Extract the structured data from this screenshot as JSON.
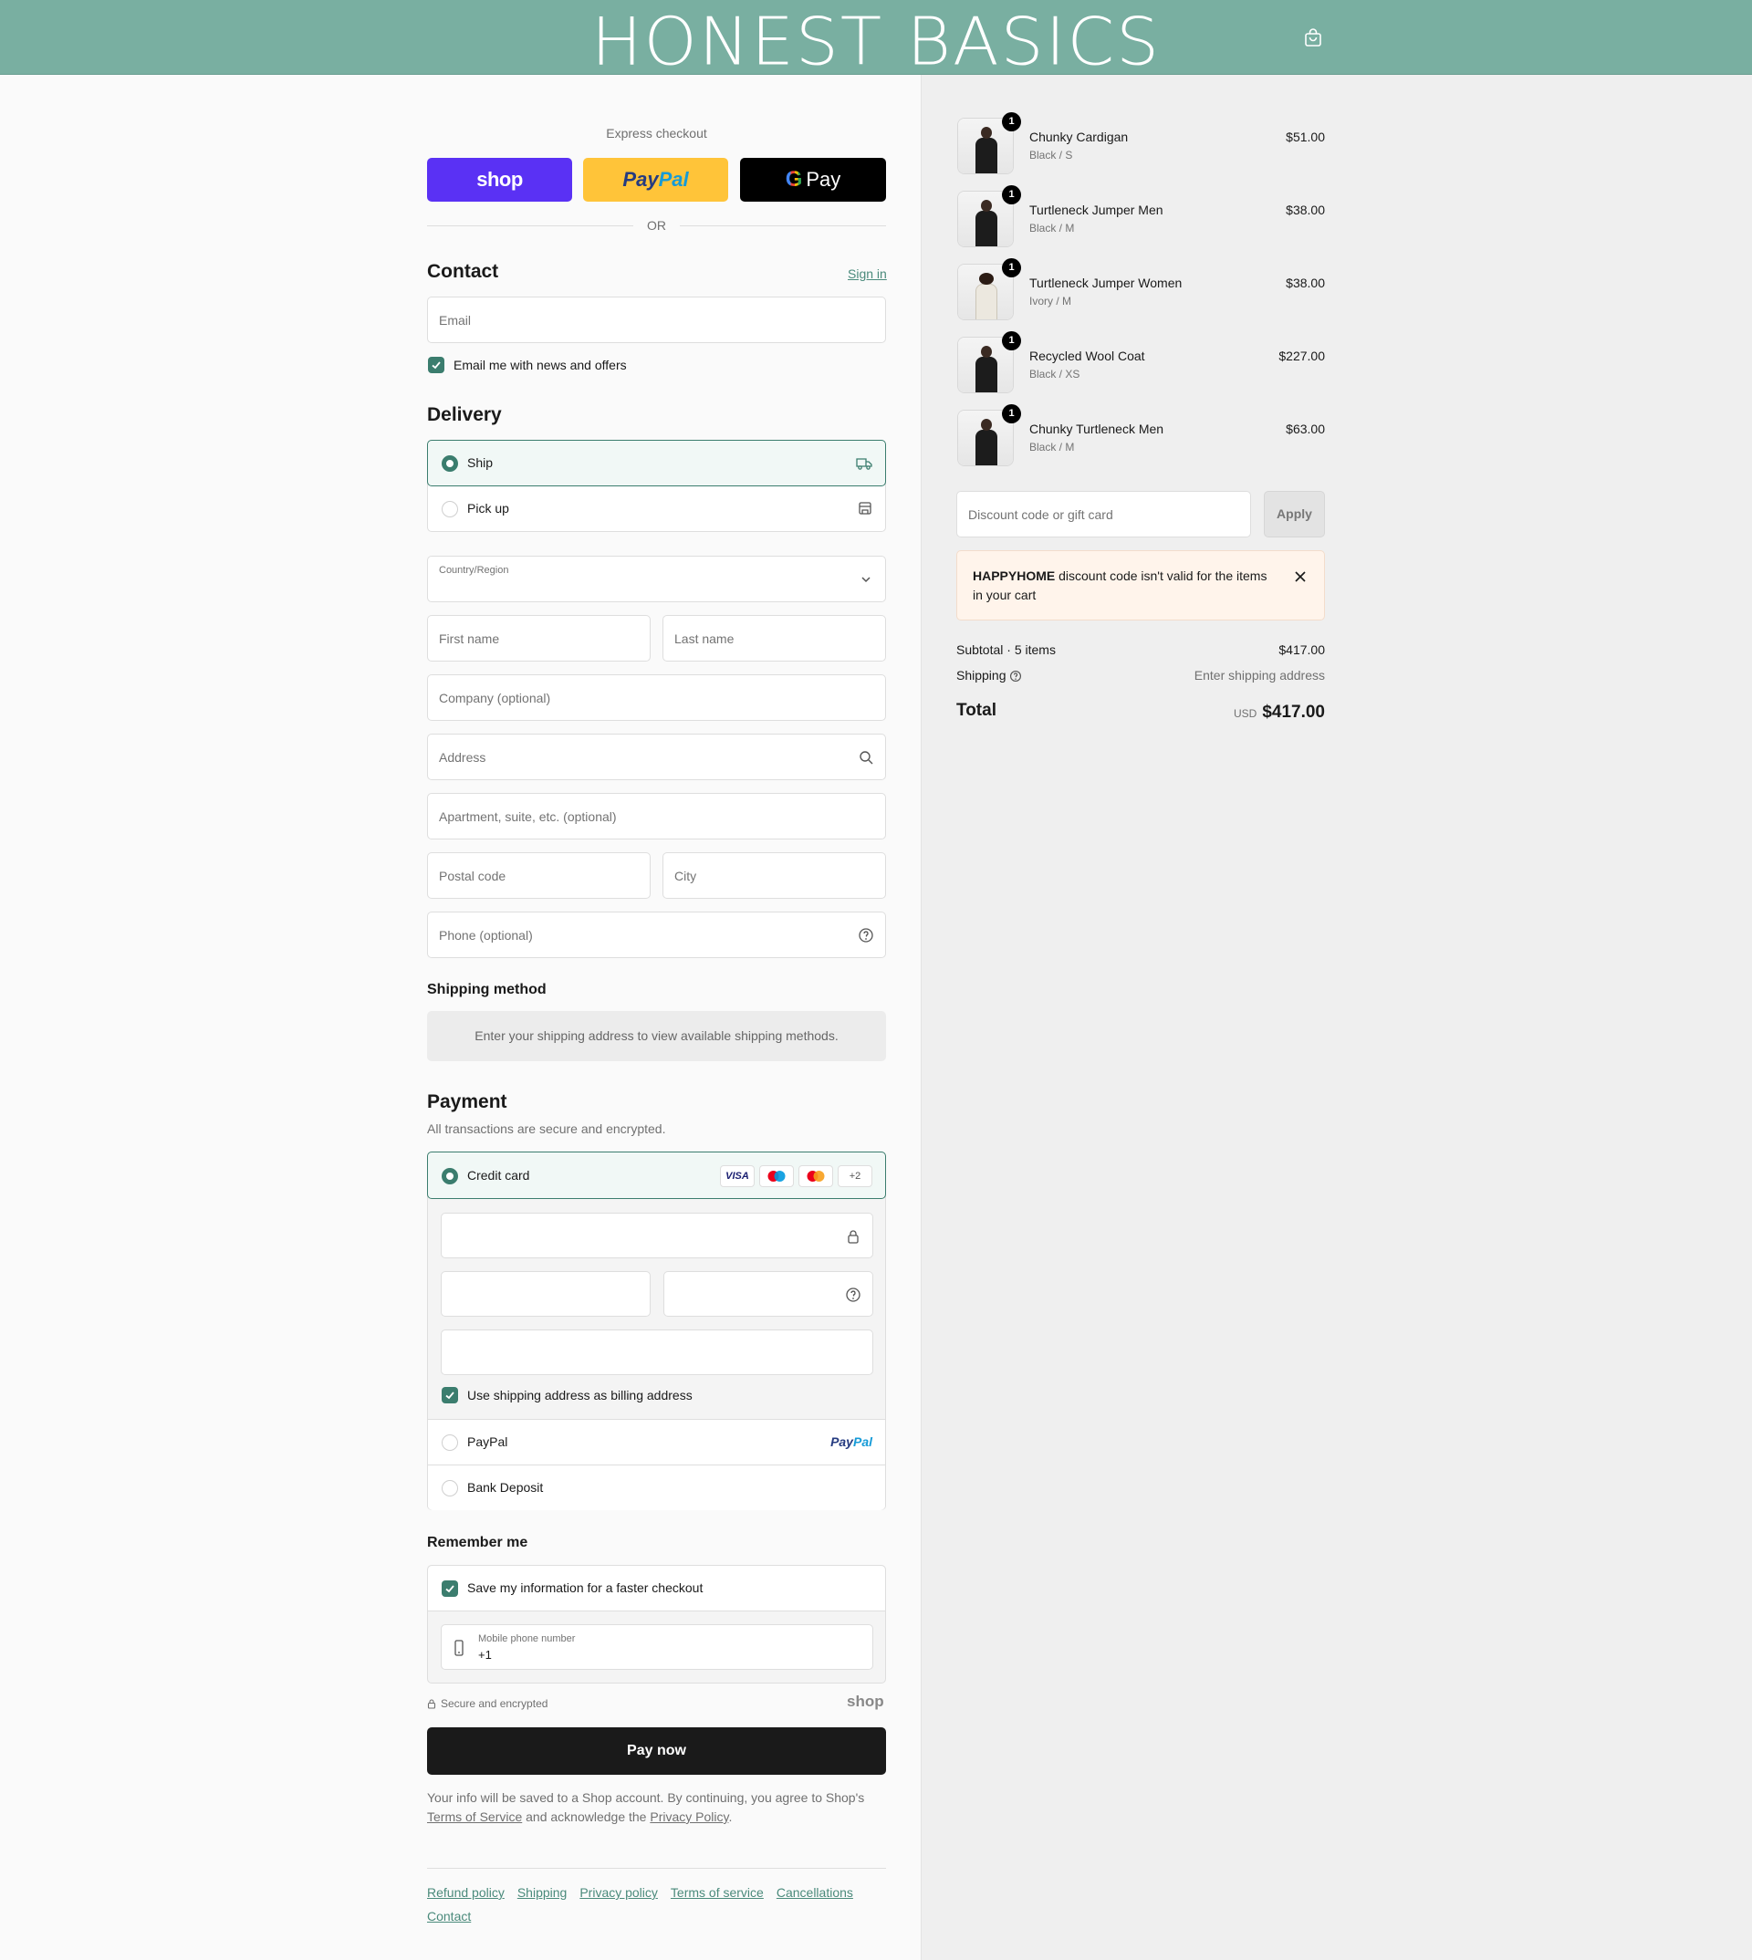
{
  "header": {
    "brand": "HONEST BASICS",
    "cart_icon": "shopping-bag-icon",
    "bg_color": "#79afa1"
  },
  "express": {
    "label": "Express checkout",
    "shop": "shop",
    "paypal_a": "Pay",
    "paypal_b": "Pal",
    "gpay_g": "G",
    "gpay_text": "Pay",
    "or": "OR"
  },
  "contact": {
    "title": "Contact",
    "sign_in": "Sign in",
    "email_placeholder": "Email",
    "news_label": "Email me with news and offers",
    "news_checked": true
  },
  "delivery": {
    "title": "Delivery",
    "options": [
      {
        "label": "Ship",
        "selected": true,
        "icon": "truck-icon"
      },
      {
        "label": "Pick up",
        "selected": false,
        "icon": "store-icon"
      }
    ],
    "country_label": "Country/Region",
    "first_name": "First name",
    "last_name": "Last name",
    "company": "Company (optional)",
    "address": "Address",
    "apartment": "Apartment, suite, etc. (optional)",
    "postal": "Postal code",
    "city": "City",
    "phone": "Phone (optional)"
  },
  "shipping_method": {
    "title": "Shipping method",
    "notice": "Enter your shipping address to view available shipping methods."
  },
  "payment": {
    "title": "Payment",
    "subtitle": "All transactions are secure and encrypted.",
    "credit_card": "Credit card",
    "cards": [
      "VISA",
      "+2"
    ],
    "billing_label": "Use shipping address as billing address",
    "paypal": "PayPal",
    "paypal_logo_a": "Pay",
    "paypal_logo_b": "Pal",
    "bank": "Bank Deposit"
  },
  "remember": {
    "title": "Remember me",
    "save_label": "Save my information for a faster checkout",
    "mobile_label": "Mobile phone number",
    "mobile_value": "+1",
    "secure": "Secure and encrypted",
    "shop_logo": "shop"
  },
  "pay_now": "Pay now",
  "legal": {
    "line1": "Your info will be saved to a Shop account. By continuing, you agree to Shop's",
    "terms": "Terms of Service",
    "and": " and acknowledge the ",
    "privacy": "Privacy Policy",
    "end": "."
  },
  "footer": [
    "Refund policy",
    "Shipping",
    "Privacy policy",
    "Terms of service",
    "Cancellations",
    "Contact"
  ],
  "cart": {
    "items": [
      {
        "name": "Chunky Cardigan",
        "variant": "Black / S",
        "price": "$51.00",
        "qty": "1"
      },
      {
        "name": "Turtleneck Jumper Men",
        "variant": "Black / M",
        "price": "$38.00",
        "qty": "1"
      },
      {
        "name": "Turtleneck Jumper Women",
        "variant": "Ivory / M",
        "price": "$38.00",
        "qty": "1"
      },
      {
        "name": "Recycled Wool Coat",
        "variant": "Black / XS",
        "price": "$227.00",
        "qty": "1"
      },
      {
        "name": "Chunky Turtleneck Men",
        "variant": "Black / M",
        "price": "$63.00",
        "qty": "1"
      }
    ],
    "discount_placeholder": "Discount code or gift card",
    "apply": "Apply",
    "warning_code": "HAPPYHOME",
    "warning_text": " discount code isn't valid for the items in your cart",
    "subtotal_label": "Subtotal · 5 items",
    "subtotal_value": "$417.00",
    "shipping_label": "Shipping",
    "shipping_value": "Enter shipping address",
    "total_label": "Total",
    "currency": "USD",
    "total_value": "$417.00"
  }
}
